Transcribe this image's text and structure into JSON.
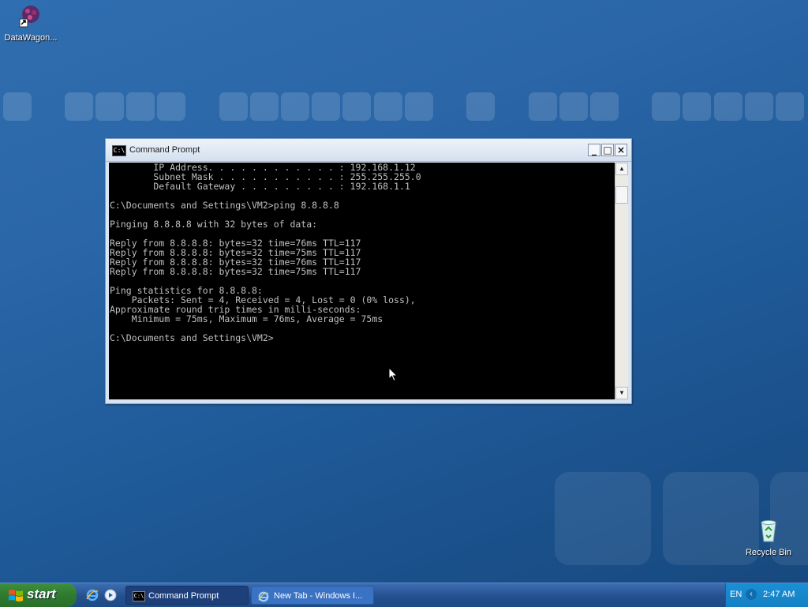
{
  "desktop": {
    "icons": [
      {
        "label": "DataWagon...",
        "icon": "datawagon-shortcut-icon"
      },
      {
        "label": "Recycle Bin",
        "icon": "recycle-bin-icon"
      }
    ]
  },
  "window": {
    "title": "Command Prompt",
    "icon": "cmd-icon",
    "buttons": {
      "minimize": "_",
      "maximize": "□",
      "close": "×"
    },
    "console_lines": [
      "        IP Address. . . . . . . . . . . . : 192.168.1.12",
      "        Subnet Mask . . . . . . . . . . . : 255.255.255.0",
      "        Default Gateway . . . . . . . . . : 192.168.1.1",
      "",
      "C:\\Documents and Settings\\VM2>ping 8.8.8.8",
      "",
      "Pinging 8.8.8.8 with 32 bytes of data:",
      "",
      "Reply from 8.8.8.8: bytes=32 time=76ms TTL=117",
      "Reply from 8.8.8.8: bytes=32 time=75ms TTL=117",
      "Reply from 8.8.8.8: bytes=32 time=76ms TTL=117",
      "Reply from 8.8.8.8: bytes=32 time=75ms TTL=117",
      "",
      "Ping statistics for 8.8.8.8:",
      "    Packets: Sent = 4, Received = 4, Lost = 0 (0% loss),",
      "Approximate round trip times in milli-seconds:",
      "    Minimum = 75ms, Maximum = 76ms, Average = 75ms",
      "",
      "C:\\Documents and Settings\\VM2>"
    ]
  },
  "taskbar": {
    "start_label": "start",
    "quick_launch": [
      "internet-explorer-icon",
      "media-player-icon"
    ],
    "tasks": [
      {
        "label": "Command Prompt",
        "icon": "cmd-icon",
        "active": true
      },
      {
        "label": "New Tab - Windows I...",
        "icon": "internet-explorer-icon",
        "active": false
      }
    ],
    "tray": {
      "language": "EN",
      "chevron": "‹",
      "clock": "2:47 AM"
    }
  },
  "colors": {
    "desktop_bg": "#2a66a8",
    "console_bg": "#000000",
    "console_fg": "#c0c0c0",
    "taskbar": "#2a5595",
    "start_green": "#2e7a2e",
    "tray": "#1580c4"
  }
}
